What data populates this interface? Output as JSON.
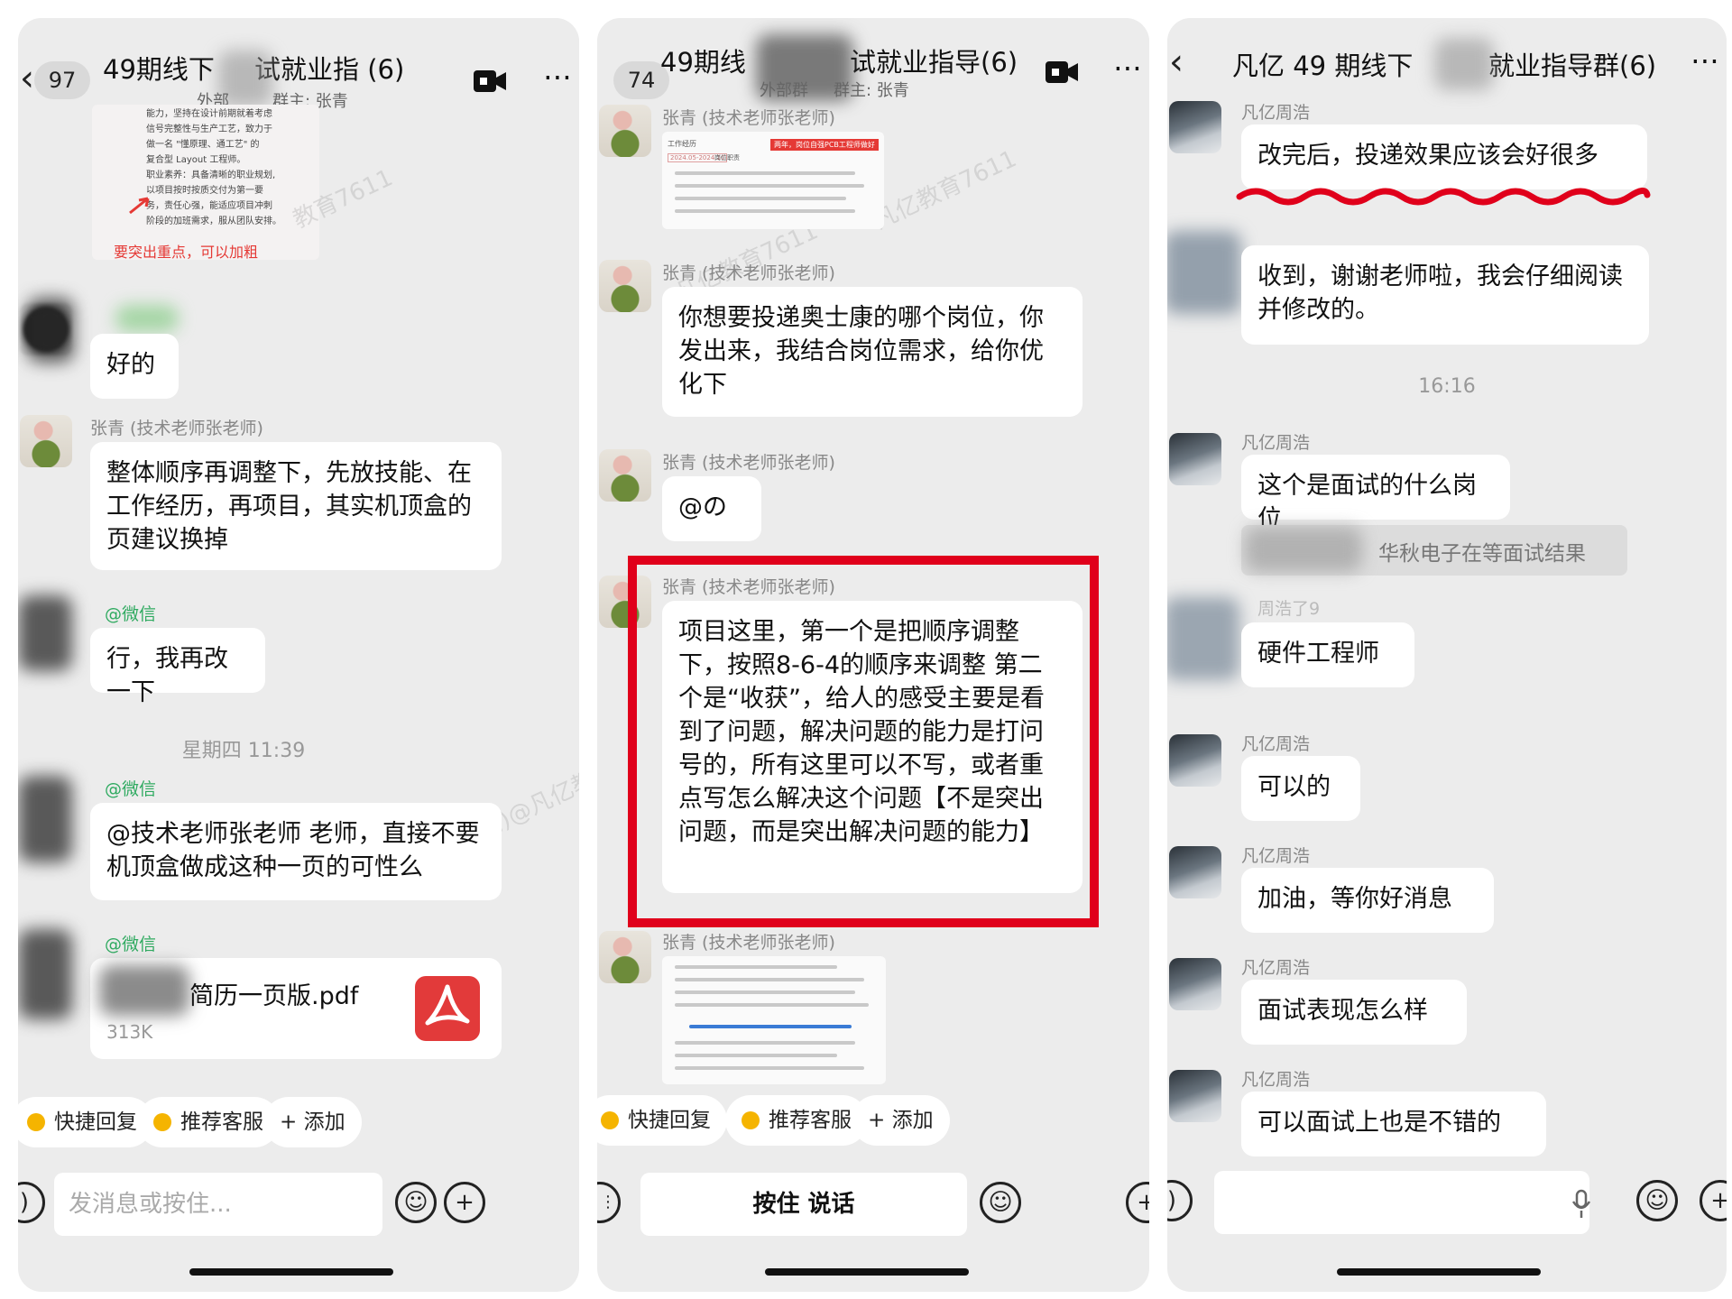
{
  "panel1": {
    "header": {
      "badge": "97",
      "title": "49期线下",
      "title_suffix": "试就业指 (6)",
      "sub_prefix": "外部",
      "sub": "群主: 张青"
    },
    "image_caption": "要突出重点，可以加粗",
    "image_text": [
      "能力，坚持在设计前期就着考虑",
      "信号完整性与生产工艺，致力于",
      "做一名 \"懂原理、通工艺\" 的",
      "复合型 Layout 工程师。",
      "职业素养：具备清晰的职业规划,",
      "以项目按时按质交付为第一要",
      "务，责任心强，能适应项目冲刺",
      "阶段的加班需求，服从团队安排。"
    ],
    "watermark": "教育7611",
    "messages": [
      {
        "sender": "",
        "text": "好的"
      },
      {
        "sender": "张青 (技术老师张老师)",
        "text": "整体顺序再调整下，先放技能、在工作经历，再项目，其实机顶盒的页建议换掉"
      },
      {
        "sender": "@微信",
        "text": "行，我再改一下"
      },
      {
        "sender": "@微信",
        "text": "@技术老师张老师 老师，直接不要机顶盒做成这种一页的可性么"
      },
      {
        "sender": "@微信",
        "text": ""
      }
    ],
    "timestamp": "星期四 11:39",
    "file": {
      "name": "简历一页版.pdf",
      "size": "313K"
    },
    "quick": [
      "快捷回复",
      "推荐客服",
      "+ 添加"
    ],
    "input_placeholder": "发消息或按住..."
  },
  "panel2": {
    "header": {
      "badge": "74",
      "title": "49期线",
      "title_suffix": "试就业指导(6)",
      "sub_prefix": "外部群",
      "sub": "群主: 张青"
    },
    "sender": "张青 (技术老师张老师)",
    "watermark": "凡亿教育7611",
    "watermark2": "凡亿教育江门)@凡亿教育7611",
    "image1_text": [
      "工作经历",
      "2024.05-2024.10",
      "岗位职责",
      "两年，岗位自强PCB工程师做好"
    ],
    "messages": [
      {
        "text": "你想要投递奥士康的哪个岗位，你发出来，我结合岗位需求，给你优化下"
      },
      {
        "text": "@の"
      },
      {
        "text": "项目这里，第一个是把顺序调整下，按照8-6-4的顺序来调整 第二个是“收获”，给人的感受主要是看到了问题，解决问题的能力是打问号的，所有这里可以不写，或者重点写怎么解决这个问题【不是突出问题，而是突出解决问题的能力】"
      }
    ],
    "quick": [
      "快捷回复",
      "推荐客服",
      "+ 添加"
    ],
    "input_hold": "按住 说话"
  },
  "panel3": {
    "header": {
      "title": "凡亿 49 期线下",
      "title_suffix": "就业指导群(6)"
    },
    "sender": "凡亿周浩",
    "messages": [
      {
        "text": "改完后，投递效果应该会好很多"
      },
      {
        "text": "收到，谢谢老师啦，我会仔细阅读并修改的。"
      },
      {
        "text": "这个是面试的什么岗位"
      },
      {
        "text": "硬件工程师"
      },
      {
        "text": "可以的"
      },
      {
        "text": "加油，等你好消息"
      },
      {
        "text": "面试表现怎么样"
      },
      {
        "text": "可以面试上也是不错的"
      }
    ],
    "timestamp": "16:16",
    "quoted_reply": "华秋电子在等面试结果",
    "quoted_sender": "周浩了9"
  },
  "colors": {
    "panel_bg": "#ececec",
    "bubble_bg": "#ffffff",
    "highlight_red": "#e0001b",
    "green_sender": "#2faa60",
    "pdf_red": "#e23a3a",
    "underline_red": "#e0001b"
  },
  "icons": [
    "back-icon",
    "video-call-icon",
    "more-icon",
    "voice-icon",
    "emoji-icon",
    "plus-icon",
    "mic-icon",
    "pdf-icon",
    "keyboard-icon"
  ]
}
